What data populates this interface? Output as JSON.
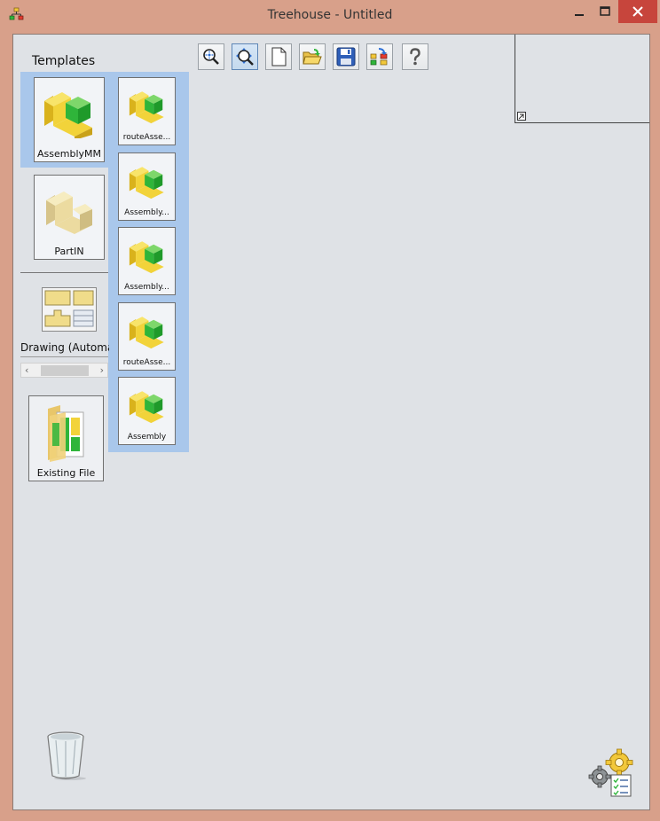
{
  "window": {
    "title": "Treehouse - Untitled",
    "minimize_glyph": "—",
    "maximize_glyph": "☐",
    "close_glyph": "✕"
  },
  "templates": {
    "label": "Templates",
    "main": [
      {
        "label": "AssemblyMM",
        "icon": "assembly-icon",
        "selected": true
      },
      {
        "label": "PartIN",
        "icon": "part-icon",
        "selected": false
      }
    ],
    "drawing": {
      "label": "Drawing (Automat",
      "icon": "drawing-icon"
    },
    "existing": {
      "label": "Existing File",
      "icon": "folder-icon"
    },
    "sub": [
      {
        "label": "routeAsse...",
        "icon": "assembly-icon"
      },
      {
        "label": "Assembly...",
        "icon": "assembly-icon"
      },
      {
        "label": "Assembly...",
        "icon": "assembly-icon"
      },
      {
        "label": "routeAsse...",
        "icon": "assembly-icon"
      },
      {
        "label": "Assembly",
        "icon": "assembly-icon"
      }
    ]
  },
  "scrollbar": {
    "left_arrow": "‹",
    "right_arrow": "›"
  },
  "toolbar": [
    {
      "name": "zoom-fit-button",
      "icon": "zoom-fit-icon"
    },
    {
      "name": "zoom-window-button",
      "icon": "zoom-window-icon",
      "active": true
    },
    {
      "name": "new-button",
      "icon": "new-document-icon"
    },
    {
      "name": "open-button",
      "icon": "open-folder-icon"
    },
    {
      "name": "save-button",
      "icon": "save-icon"
    },
    {
      "name": "update-button",
      "icon": "update-icon"
    },
    {
      "name": "help-button",
      "icon": "help-icon"
    }
  ],
  "colors": {
    "frame": "#d8a08a",
    "client": "#dfe2e6",
    "highlight": "#a9c7eb",
    "close": "#c7453c",
    "part_yellow": "#f2d33a",
    "part_green": "#2fb53a"
  }
}
